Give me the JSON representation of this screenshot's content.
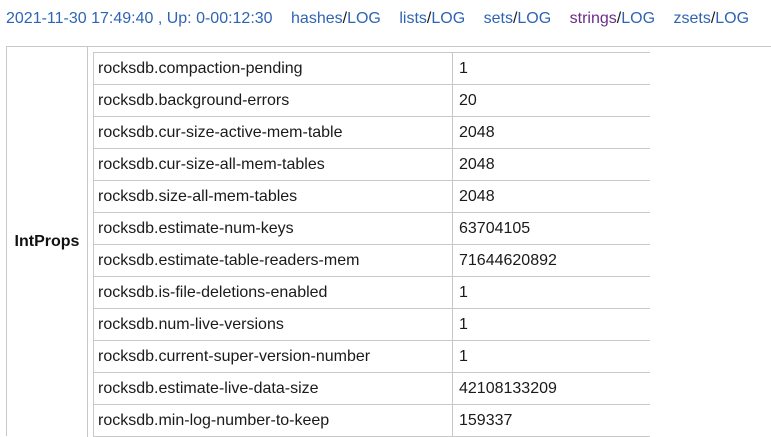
{
  "header": {
    "status": "2021-11-30 17:49:40 , Up: 0-00:12:30",
    "links": [
      {
        "name": "hashes",
        "log": "LOG"
      },
      {
        "name": "lists",
        "log": "LOG"
      },
      {
        "name": "sets",
        "log": "LOG"
      },
      {
        "name": "strings",
        "log": "LOG"
      },
      {
        "name": "zsets",
        "log": "LOG"
      }
    ],
    "separator": "/"
  },
  "group": {
    "label": "IntProps"
  },
  "rows": [
    {
      "key": "rocksdb.compaction-pending",
      "value": "1"
    },
    {
      "key": "rocksdb.background-errors",
      "value": "20"
    },
    {
      "key": "rocksdb.cur-size-active-mem-table",
      "value": "2048"
    },
    {
      "key": "rocksdb.cur-size-all-mem-tables",
      "value": "2048"
    },
    {
      "key": "rocksdb.size-all-mem-tables",
      "value": "2048"
    },
    {
      "key": "rocksdb.estimate-num-keys",
      "value": "63704105"
    },
    {
      "key": "rocksdb.estimate-table-readers-mem",
      "value": "71644620892"
    },
    {
      "key": "rocksdb.is-file-deletions-enabled",
      "value": "1"
    },
    {
      "key": "rocksdb.num-live-versions",
      "value": "1"
    },
    {
      "key": "rocksdb.current-super-version-number",
      "value": "1"
    },
    {
      "key": "rocksdb.estimate-live-data-size",
      "value": "42108133209"
    },
    {
      "key": "rocksdb.min-log-number-to-keep",
      "value": "159337"
    }
  ],
  "colors": {
    "link": "#2f64b4",
    "visited_link": "#6a2e8a",
    "border": "#c8c8c8",
    "text": "#1a1a1a"
  }
}
